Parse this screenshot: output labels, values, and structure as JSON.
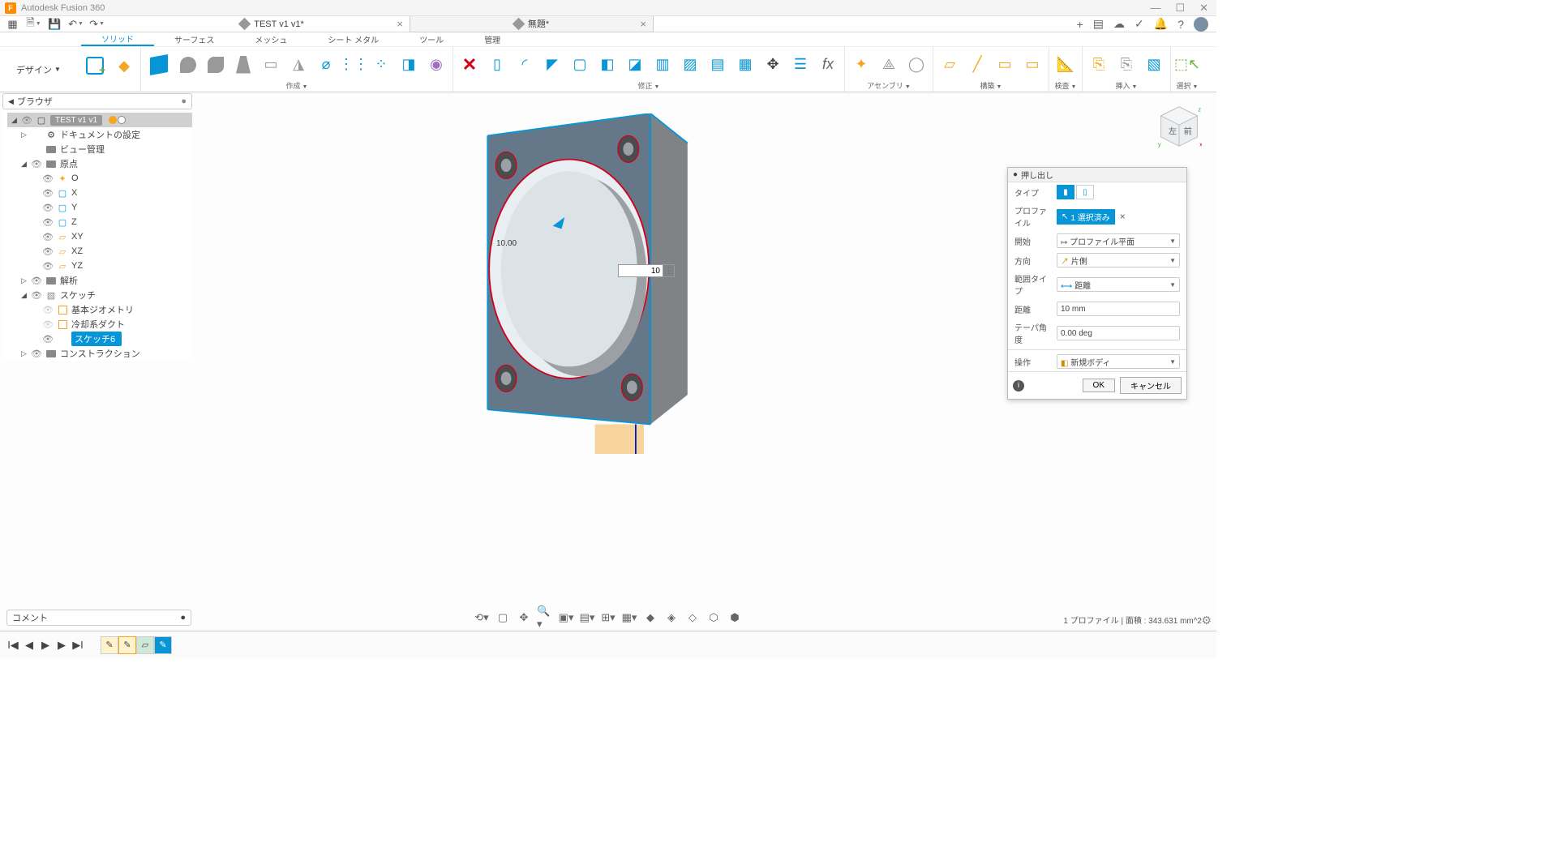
{
  "app": {
    "title": "Autodesk Fusion 360"
  },
  "docTabs": [
    {
      "label": "TEST v1 v1*",
      "active": true
    },
    {
      "label": "無題*",
      "active": false
    }
  ],
  "ribbonTabs": [
    "ソリッド",
    "サーフェス",
    "メッシュ",
    "シート メタル",
    "ツール",
    "管理"
  ],
  "ribbonTabActive": 0,
  "designBtn": "デザイン",
  "ribbonGroups": {
    "create": "作成",
    "modify": "修正",
    "assemble": "アセンブリ",
    "construct": "構築",
    "inspect": "検査",
    "insert": "挿入",
    "select": "選択"
  },
  "browser": {
    "title": "ブラウザ",
    "root": "TEST v1 v1",
    "items": [
      {
        "label": "ドキュメントの設定",
        "icon": "gear",
        "indent": 1,
        "tri": "▷",
        "eye": ""
      },
      {
        "label": "ビュー管理",
        "icon": "folder",
        "indent": 1,
        "tri": "",
        "eye": ""
      },
      {
        "label": "原点",
        "icon": "folder",
        "indent": 1,
        "tri": "◢",
        "eye": "on"
      },
      {
        "label": "O",
        "icon": "origin",
        "indent": 2,
        "tri": "",
        "eye": "on"
      },
      {
        "label": "X",
        "icon": "axis",
        "indent": 2,
        "tri": "",
        "eye": "on"
      },
      {
        "label": "Y",
        "icon": "axis",
        "indent": 2,
        "tri": "",
        "eye": "on"
      },
      {
        "label": "Z",
        "icon": "axis",
        "indent": 2,
        "tri": "",
        "eye": "on"
      },
      {
        "label": "XY",
        "icon": "plane",
        "indent": 2,
        "tri": "",
        "eye": "on"
      },
      {
        "label": "XZ",
        "icon": "plane",
        "indent": 2,
        "tri": "",
        "eye": "on"
      },
      {
        "label": "YZ",
        "icon": "plane",
        "indent": 2,
        "tri": "",
        "eye": "on"
      },
      {
        "label": "解析",
        "icon": "folder",
        "indent": 1,
        "tri": "▷",
        "eye": "on"
      },
      {
        "label": "スケッチ",
        "icon": "sketch-folder",
        "indent": 1,
        "tri": "◢",
        "eye": "on"
      },
      {
        "label": "基本ジオメトリ",
        "icon": "sketch",
        "indent": 2,
        "tri": "",
        "eye": "off"
      },
      {
        "label": "冷却系ダクト",
        "icon": "sketch",
        "indent": 2,
        "tri": "",
        "eye": "off"
      },
      {
        "label": "スケッチ6",
        "icon": "sketch-active",
        "indent": 2,
        "tri": "",
        "eye": "on",
        "active": true
      },
      {
        "label": "コンストラクション",
        "icon": "folder",
        "indent": 1,
        "tri": "▷",
        "eye": "on"
      }
    ]
  },
  "dialog": {
    "title": "押し出し",
    "rows": {
      "type": "タイプ",
      "profile": "プロファイル",
      "profileChip": "1 選択済み",
      "start": "開始",
      "startVal": "プロファイル平面",
      "direction": "方向",
      "directionVal": "片側",
      "extentType": "範囲タイプ",
      "extentVal": "距離",
      "distance": "距離",
      "distanceVal": "10 mm",
      "taper": "テーパ角度",
      "taperVal": "0.00 deg",
      "operation": "操作",
      "operationVal": "新規ボディ"
    },
    "ok": "OK",
    "cancel": "キャンセル"
  },
  "floatInput": "10",
  "dimLabel": "10.00",
  "comments": "コメント",
  "status": "1 プロファイル | 面積 : 343.631 mm^2",
  "viewcube": {
    "left": "左",
    "front": "前"
  }
}
